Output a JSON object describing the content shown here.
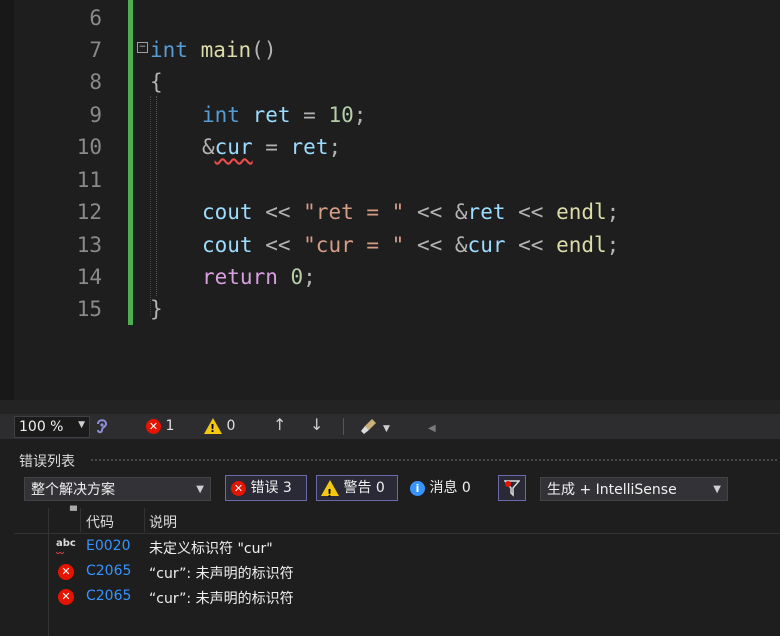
{
  "editor": {
    "line_numbers": [
      "6",
      "7",
      "8",
      "9",
      "10",
      "11",
      "12",
      "13",
      "14",
      "15"
    ]
  },
  "code": {
    "l7_kw": "int",
    "l7_fn": "main",
    "l7_paren": "()",
    "l8_brace": "{",
    "l9_kw": "int",
    "l9_var": "ret",
    "l9_op": " = ",
    "l9_num": "10",
    "l9_semi": ";",
    "l10_amp": "&",
    "l10_var": "cur",
    "l10_op": " = ",
    "l10_var2": "ret",
    "l10_semi": ";",
    "l12_cout": "cout",
    "l12_op1": " << ",
    "l12_str": "\"ret = \"",
    "l12_op2": " << ",
    "l12_amp": "&",
    "l12_var": "ret",
    "l12_op3": " << ",
    "l12_endl": "endl",
    "l12_semi": ";",
    "l13_cout": "cout",
    "l13_op1": " << ",
    "l13_str": "\"cur = \"",
    "l13_op2": " << ",
    "l13_amp": "&",
    "l13_var": "cur",
    "l13_op3": " << ",
    "l13_endl": "endl",
    "l13_semi": ";",
    "l14_ret": "return",
    "l14_num": "0",
    "l14_semi": ";",
    "l15_brace": "}"
  },
  "status_bar": {
    "zoom": "100 %",
    "error_count": "1",
    "warning_count": "0"
  },
  "error_list": {
    "title": "错误列表",
    "scope_combo": "整个解决方案",
    "errors_filter": "错误 3",
    "warnings_filter": "警告 0",
    "messages_filter": "消息 0",
    "source_combo": "生成 + IntelliSense",
    "col_code": "代码",
    "col_desc": "说明",
    "rows": [
      {
        "icon": "abc-squiggle-icon",
        "code": "E0020",
        "desc": "未定义标识符 \"cur\""
      },
      {
        "icon": "error-icon",
        "code": "C2065",
        "desc": "“cur”: 未声明的标识符"
      },
      {
        "icon": "error-icon",
        "code": "C2065",
        "desc": "“cur”: 未声明的标识符"
      }
    ]
  },
  "colors": {
    "error": "#e51400",
    "warning": "#f2c811",
    "info": "#3794ff",
    "change_bar": "#4caf50"
  }
}
